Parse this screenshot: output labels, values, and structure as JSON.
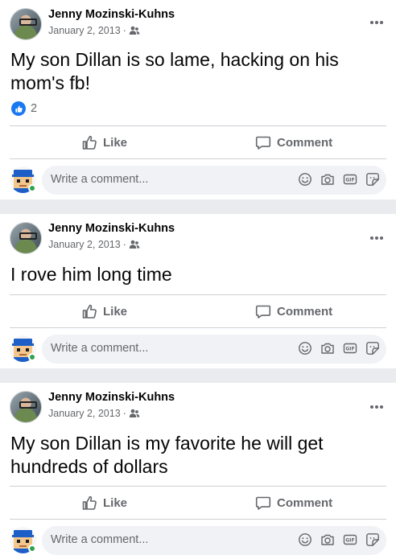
{
  "posts": [
    {
      "author": "Jenny Mozinski-Kuhns",
      "date": "January 2, 2013",
      "separator": "·",
      "text": "My son Dillan is so lame, hacking on his mom's fb!",
      "reaction_count": "2"
    },
    {
      "author": "Jenny Mozinski-Kuhns",
      "date": "January 2, 2013",
      "separator": "·",
      "text": "I rove him long time"
    },
    {
      "author": "Jenny Mozinski-Kuhns",
      "date": "January 2, 2013",
      "separator": "·",
      "text": "My son Dillan is my favorite he will get hundreds of dollars"
    }
  ],
  "actions": {
    "like_label": "Like",
    "comment_label": "Comment"
  },
  "comment_box": {
    "placeholder": "Write a comment..."
  },
  "icons": {
    "audience": "friends-icon",
    "more": "more-options-icon",
    "like": "thumbs-up-icon",
    "comment": "comment-bubble-icon",
    "emoji": "emoji-icon",
    "camera": "camera-icon",
    "gif": "gif-icon",
    "sticker": "sticker-icon"
  },
  "colors": {
    "brand": "#1877f2",
    "online": "#31a24c",
    "secondary_text": "#65676b",
    "comment_bg": "#f0f2f5"
  }
}
